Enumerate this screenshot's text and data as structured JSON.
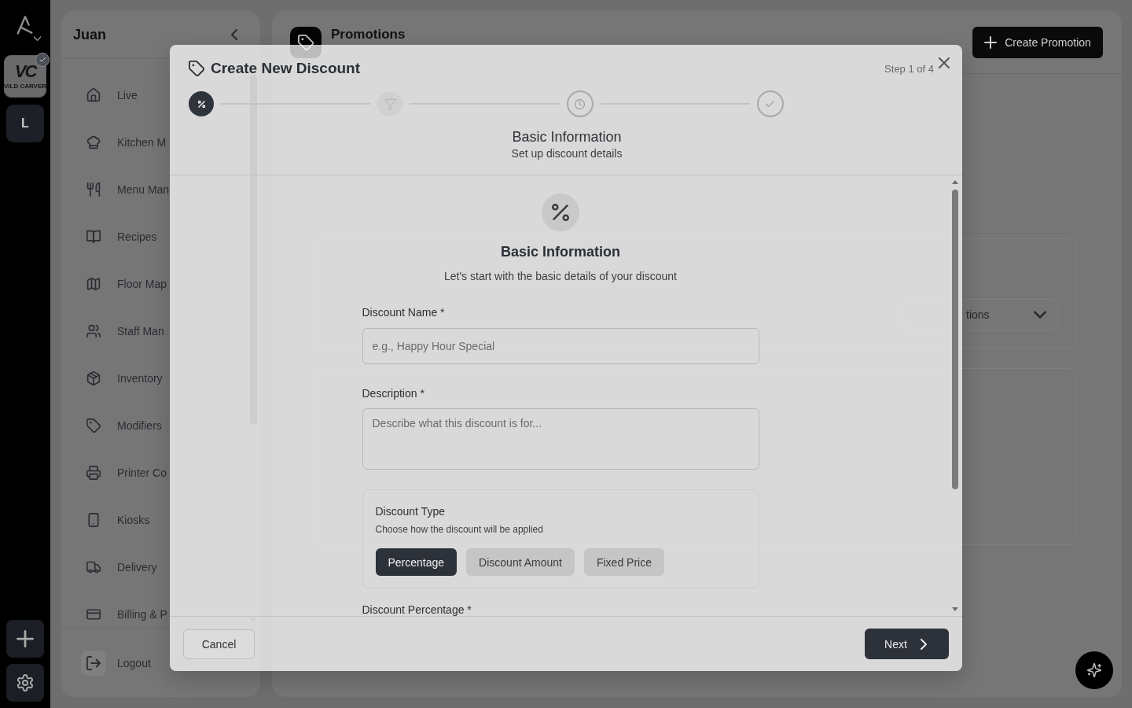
{
  "rail": {
    "workspaces": [
      {
        "kind": "logo",
        "monogram": "VC",
        "name": "VILD CARVER",
        "selected": true
      },
      {
        "kind": "letter",
        "label": "L",
        "selected": false
      }
    ]
  },
  "sidebar": {
    "title": "Juan",
    "items": [
      {
        "label": "Live",
        "selected": false
      },
      {
        "label": "Kitchen M",
        "selected": false
      },
      {
        "label": "Menu Man",
        "selected": false
      },
      {
        "label": "Recipes",
        "selected": false
      },
      {
        "label": "Floor Map",
        "selected": false
      },
      {
        "label": "Staff Man",
        "selected": false
      },
      {
        "label": "Inventory",
        "selected": false
      },
      {
        "label": "Modifiers",
        "selected": false
      },
      {
        "label": "Printer Co",
        "selected": false
      },
      {
        "label": "Kiosks",
        "selected": false
      },
      {
        "label": "Delivery",
        "selected": false
      },
      {
        "label": "Billing & P",
        "selected": false
      }
    ],
    "logout": "Logout"
  },
  "page": {
    "title": "Promotions",
    "create_button": "Create Promotion",
    "filters": {
      "status_select": {
        "value": "tions"
      }
    }
  },
  "modal": {
    "title": "Create New Discount",
    "step_counter": "Step 1 of 4",
    "steps": [
      {
        "kind": "filled",
        "selected": true
      },
      {
        "kind": "filled",
        "selected": false
      },
      {
        "kind": "ring",
        "selected": false
      },
      {
        "kind": "ring",
        "selected": false
      }
    ],
    "step_caption": {
      "title": "Basic Information",
      "subtitle": "Set up discount details"
    },
    "section": {
      "title": "Basic Information",
      "subtitle": "Let's start with the basic details of your discount"
    },
    "fields": [
      {
        "kind": "input",
        "label": "Discount Name *",
        "placeholder": "e.g., Happy Hour Special"
      },
      {
        "kind": "textarea",
        "label": "Description *",
        "placeholder": "Describe what this discount is for..."
      }
    ],
    "discount_type": {
      "title": "Discount Type",
      "hint": "Choose how the discount will be applied",
      "options": [
        {
          "label": "Percentage",
          "selected": true
        },
        {
          "label": "Discount Amount",
          "selected": false
        },
        {
          "label": "Fixed Price",
          "selected": false
        }
      ]
    },
    "percentage_field": {
      "label": "Discount Percentage *"
    },
    "cancel_button": "Cancel",
    "next_button": "Next"
  }
}
